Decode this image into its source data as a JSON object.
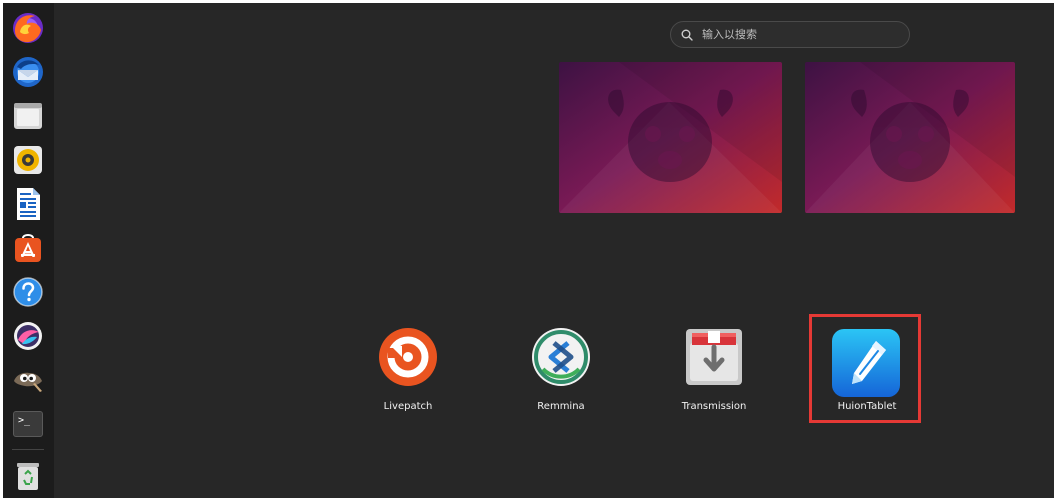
{
  "dock": {
    "items": [
      {
        "name": "firefox",
        "icon": "firefox-icon"
      },
      {
        "name": "thunderbird",
        "icon": "thunderbird-icon"
      },
      {
        "name": "files",
        "icon": "folder-icon"
      },
      {
        "name": "rhythmbox",
        "icon": "speaker-icon"
      },
      {
        "name": "libreoffice-writer",
        "icon": "document-icon"
      },
      {
        "name": "app-center",
        "icon": "app-store-icon"
      },
      {
        "name": "help",
        "icon": "help-icon"
      },
      {
        "name": "krita",
        "icon": "paint-icon"
      },
      {
        "name": "gimp",
        "icon": "gimp-icon"
      },
      {
        "name": "terminal",
        "icon": "terminal-icon"
      },
      {
        "name": "trash",
        "icon": "trash-icon"
      }
    ],
    "terminal_glyph": ">_"
  },
  "search": {
    "placeholder": "输入以搜索",
    "icon": "search-icon"
  },
  "workspaces": [
    {
      "name": "workspace-1"
    },
    {
      "name": "workspace-2"
    }
  ],
  "apps": [
    {
      "label": "Livepatch",
      "icon": "livepatch-icon"
    },
    {
      "label": "Remmina",
      "icon": "remmina-icon"
    },
    {
      "label": "Transmission",
      "icon": "transmission-icon"
    },
    {
      "label": "HuionTablet",
      "icon": "pen-icon"
    }
  ],
  "colors": {
    "background": "#272727",
    "dock": "#1c1c1c",
    "highlight": "#e53935",
    "livepatch": "#e95420",
    "huion": "#1e88e5"
  }
}
